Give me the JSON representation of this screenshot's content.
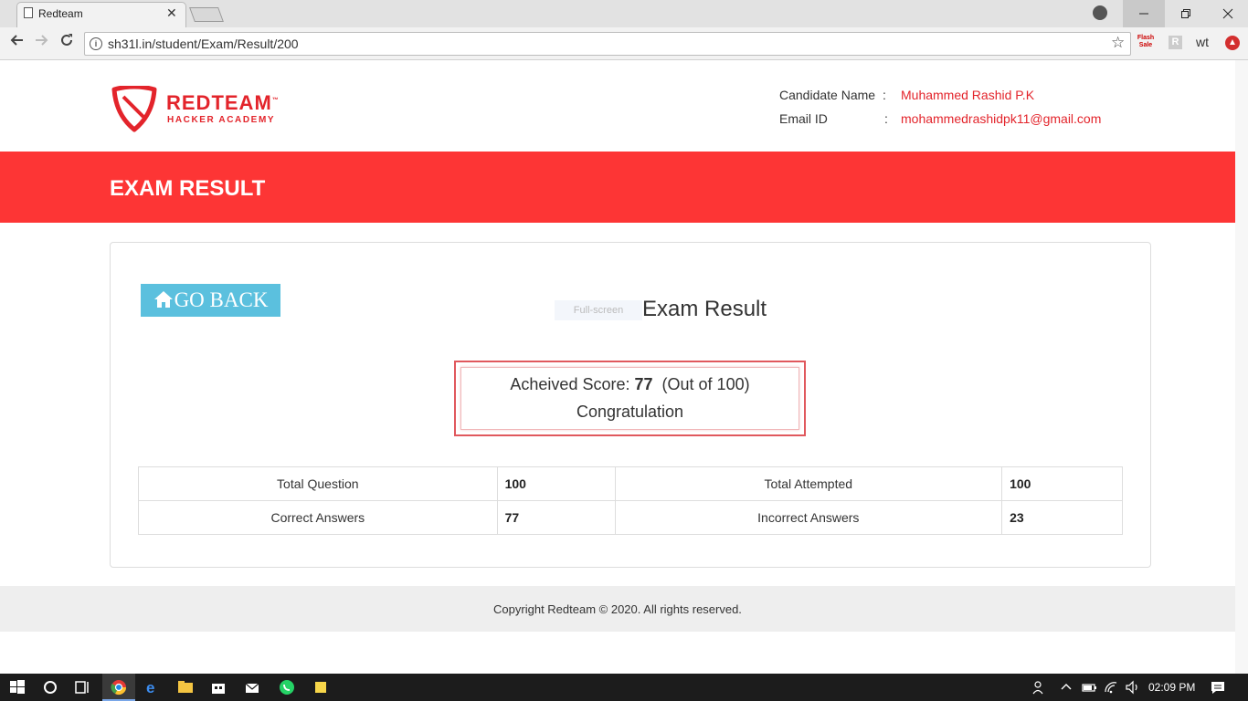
{
  "browser": {
    "tab_title": "Redteam",
    "tab_close": "✕",
    "url": "sh31l.in/student/Exam/Result/200",
    "ext_flash": "Flash Sale",
    "ext_wt": "wt",
    "ext_r": "R"
  },
  "header": {
    "logo_word": "REDTEAM",
    "logo_tm": "™",
    "logo_sub": "HACKER ACADEMY",
    "candidate_label": "Candidate Name",
    "candidate_value": "Muhammed Rashid P.K",
    "email_label": "Email ID",
    "email_value": "mohammedrashidpk11@gmail.com",
    "colon": ":"
  },
  "banner": {
    "title": "EXAM RESULT"
  },
  "result": {
    "go_back_label": "GO BACK",
    "fullscreen_label": "Full-screen",
    "heading": "Exam Result",
    "score_prefix": "Acheived Score: ",
    "score": "77",
    "score_suffix": "(Out of 100)",
    "message": "Congratulation"
  },
  "stats": {
    "rows": [
      {
        "label_a": "Total Question",
        "value_a": "100",
        "label_b": "Total Attempted",
        "value_b": "100"
      },
      {
        "label_a": "Correct Answers",
        "value_a": "77",
        "label_b": "Incorrect Answers",
        "value_b": "23"
      }
    ]
  },
  "footer": {
    "text": "Copyright Redteam © 2020. All rights reserved."
  },
  "taskbar": {
    "time": "02:09 PM"
  },
  "colors": {
    "brand_red": "#e3242b",
    "banner_red": "#fd3535",
    "go_back_blue": "#5bc0de",
    "taskbar": "#1c1c1c"
  }
}
